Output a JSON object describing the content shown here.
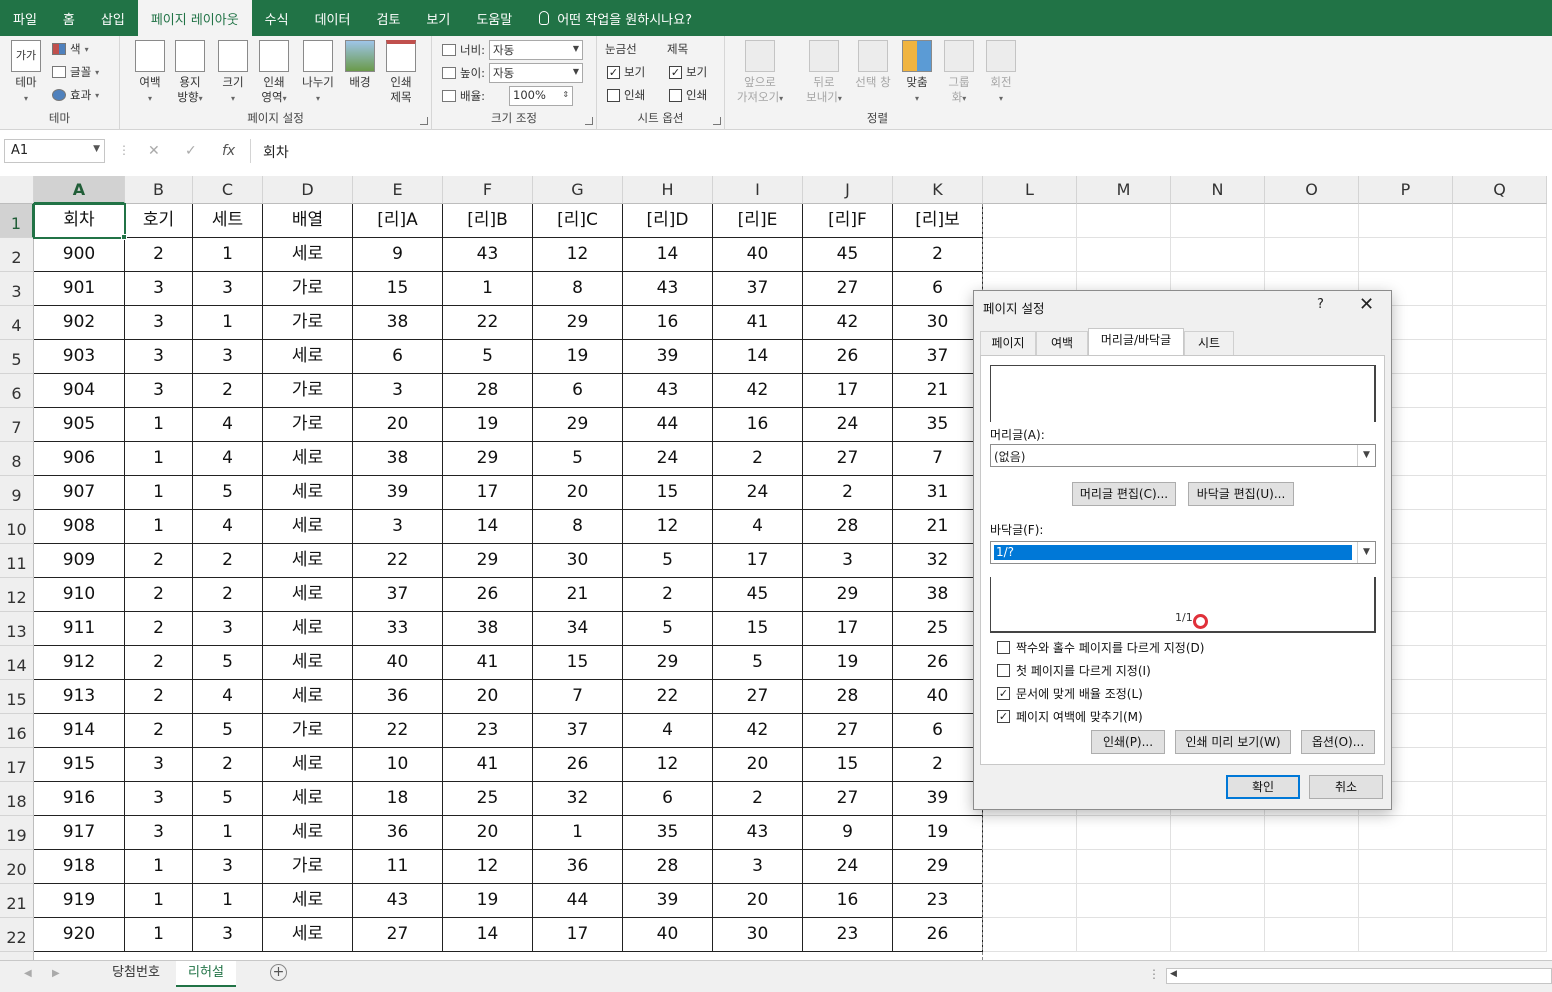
{
  "ribbon_tabs": [
    "파일",
    "홈",
    "삽입",
    "페이지 레이아웃",
    "수식",
    "데이터",
    "검토",
    "보기",
    "도움말"
  ],
  "active_tab_index": 3,
  "tell_me": "어떤 작업을 원하시나요?",
  "ribbon": {
    "theme": {
      "group_label": "테마",
      "theme_label": "테마",
      "colors": "색",
      "fonts": "글꼴",
      "effects": "효과"
    },
    "page_setup": {
      "group_label": "페이지 설정",
      "margins": "여백",
      "orientation_1": "용지",
      "orientation_2": "방향",
      "size": "크기",
      "print_area_1": "인쇄",
      "print_area_2": "영역",
      "breaks": "나누기",
      "background": "배경",
      "print_titles_1": "인쇄",
      "print_titles_2": "제목"
    },
    "scale": {
      "group_label": "크기 조정",
      "width_label": "너비:",
      "width_value": "자동",
      "height_label": "높이:",
      "height_value": "자동",
      "scale_label": "배율:",
      "scale_value": "100%"
    },
    "sheet_options": {
      "group_label": "시트 옵션",
      "gridlines": "눈금선",
      "headings": "제목",
      "view": "보기",
      "print": "인쇄",
      "gridlines_view": true,
      "gridlines_print": false,
      "headings_view": true,
      "headings_print": false
    },
    "arrange": {
      "group_label": "정렬",
      "bring_forward_1": "앞으로",
      "bring_forward_2": "가져오기",
      "send_backward_1": "뒤로",
      "send_backward_2": "보내기",
      "selection_pane": "선택 창",
      "align": "맞춤",
      "group_1": "그룹",
      "group_2": "화",
      "rotate": "회전"
    }
  },
  "formula_bar": {
    "name_box": "A1",
    "content": "회차",
    "cancel": "✕",
    "enter": "✓",
    "fx": "fx"
  },
  "columns": [
    "A",
    "B",
    "C",
    "D",
    "E",
    "F",
    "G",
    "H",
    "I",
    "J",
    "K",
    "L",
    "M",
    "N",
    "O",
    "P",
    "Q"
  ],
  "header_row": [
    "회차",
    "호기",
    "세트",
    "배열",
    "[리]A",
    "[리]B",
    "[리]C",
    "[리]D",
    "[리]E",
    "[리]F",
    "[리]보"
  ],
  "rows": [
    [
      "900",
      "2",
      "1",
      "세로",
      "9",
      "43",
      "12",
      "14",
      "40",
      "45",
      "2"
    ],
    [
      "901",
      "3",
      "3",
      "가로",
      "15",
      "1",
      "8",
      "43",
      "37",
      "27",
      "6"
    ],
    [
      "902",
      "3",
      "1",
      "가로",
      "38",
      "22",
      "29",
      "16",
      "41",
      "42",
      "30"
    ],
    [
      "903",
      "3",
      "3",
      "세로",
      "6",
      "5",
      "19",
      "39",
      "14",
      "26",
      "37"
    ],
    [
      "904",
      "3",
      "2",
      "가로",
      "3",
      "28",
      "6",
      "43",
      "42",
      "17",
      "21"
    ],
    [
      "905",
      "1",
      "4",
      "가로",
      "20",
      "19",
      "29",
      "44",
      "16",
      "24",
      "35"
    ],
    [
      "906",
      "1",
      "4",
      "세로",
      "38",
      "29",
      "5",
      "24",
      "2",
      "27",
      "7"
    ],
    [
      "907",
      "1",
      "5",
      "세로",
      "39",
      "17",
      "20",
      "15",
      "24",
      "2",
      "31"
    ],
    [
      "908",
      "1",
      "4",
      "세로",
      "3",
      "14",
      "8",
      "12",
      "4",
      "28",
      "21"
    ],
    [
      "909",
      "2",
      "2",
      "세로",
      "22",
      "29",
      "30",
      "5",
      "17",
      "3",
      "32"
    ],
    [
      "910",
      "2",
      "2",
      "세로",
      "37",
      "26",
      "21",
      "2",
      "45",
      "29",
      "38"
    ],
    [
      "911",
      "2",
      "3",
      "세로",
      "33",
      "38",
      "34",
      "5",
      "15",
      "17",
      "25"
    ],
    [
      "912",
      "2",
      "5",
      "세로",
      "40",
      "41",
      "15",
      "29",
      "5",
      "19",
      "26"
    ],
    [
      "913",
      "2",
      "4",
      "세로",
      "36",
      "20",
      "7",
      "22",
      "27",
      "28",
      "40"
    ],
    [
      "914",
      "2",
      "5",
      "가로",
      "22",
      "23",
      "37",
      "4",
      "42",
      "27",
      "6"
    ],
    [
      "915",
      "3",
      "2",
      "세로",
      "10",
      "41",
      "26",
      "12",
      "20",
      "15",
      "2"
    ],
    [
      "916",
      "3",
      "5",
      "세로",
      "18",
      "25",
      "32",
      "6",
      "2",
      "27",
      "39"
    ],
    [
      "917",
      "3",
      "1",
      "세로",
      "36",
      "20",
      "1",
      "35",
      "43",
      "9",
      "19"
    ],
    [
      "918",
      "1",
      "3",
      "가로",
      "11",
      "12",
      "36",
      "28",
      "3",
      "24",
      "29"
    ],
    [
      "919",
      "1",
      "1",
      "세로",
      "43",
      "19",
      "44",
      "39",
      "20",
      "16",
      "23"
    ],
    [
      "920",
      "1",
      "3",
      "세로",
      "27",
      "14",
      "17",
      "40",
      "30",
      "23",
      "26"
    ]
  ],
  "row_numbers": [
    "1",
    "2",
    "3",
    "4",
    "5",
    "6",
    "7",
    "8",
    "9",
    "10",
    "11",
    "12",
    "13",
    "14",
    "15",
    "16",
    "17",
    "18",
    "19",
    "20",
    "21",
    "22"
  ],
  "sheet_tabs": [
    "당첨번호",
    "리허설"
  ],
  "active_sheet_index": 1,
  "dialog": {
    "title": "페이지 설정",
    "help": "?",
    "close": "✕",
    "tabs": [
      "페이지",
      "여백",
      "머리글/바닥글",
      "시트"
    ],
    "active_tab_index": 2,
    "header_label": "머리글(A):",
    "header_value": "(없음)",
    "edit_header": "머리글 편집(C)...",
    "edit_footer": "바닥글 편집(U)...",
    "footer_label": "바닥글(F):",
    "footer_value": "1/?",
    "footer_preview": "1/1",
    "checkboxes": [
      {
        "label": "짝수와 홀수 페이지를 다르게 지정(D)",
        "checked": false
      },
      {
        "label": "첫 페이지를 다르게 지정(I)",
        "checked": false
      },
      {
        "label": "문서에 맞게 배율 조정(L)",
        "checked": true
      },
      {
        "label": "페이지 여백에 맞추기(M)",
        "checked": true
      }
    ],
    "print_button": "인쇄(P)...",
    "preview_button": "인쇄 미리 보기(W)",
    "options_button": "옵션(O)...",
    "ok_button": "확인",
    "cancel_button": "취소"
  },
  "colors": {
    "accent": "#217346",
    "selection_blue": "#0078d7"
  }
}
